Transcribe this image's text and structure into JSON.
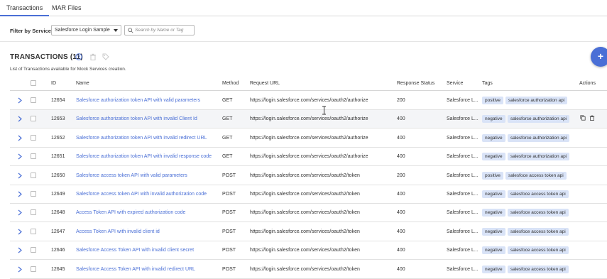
{
  "tabs": [
    {
      "label": "Transactions",
      "active": true
    },
    {
      "label": "MAR Files",
      "active": false
    }
  ],
  "filter": {
    "label": "Filter by Service:",
    "service_value": "Salesforce Login Sample",
    "search_placeholder": "Search by Name or Tag"
  },
  "section": {
    "title": "TRANSACTIONS (11)",
    "subtitle": "List of Transactions available for Mock Services creation."
  },
  "fab_label": "+",
  "columns": {
    "id": "ID",
    "name": "Name",
    "method": "Method",
    "url": "Request URL",
    "status": "Response Status",
    "service": "Service",
    "tags": "Tags",
    "actions": "Actions"
  },
  "rows": [
    {
      "id": "12654",
      "name": "Salesforce authorization token API with valid parameters",
      "method": "GET",
      "url": "https://login.salesforce.com/services/oauth2/authorize",
      "status": "200",
      "service": "Salesforce L...",
      "tag1": "positive",
      "tag2": "salesforce authorization api"
    },
    {
      "id": "12653",
      "name": "Salesforce authorization token API with invalid Client Id",
      "method": "GET",
      "url": "https://login.salesforce.com/services/oauth2/authorize",
      "status": "400",
      "service": "Salesforce L...",
      "tag1": "negative",
      "tag2": "salesforce authorization api"
    },
    {
      "id": "12652",
      "name": "Salesforce authorization token API with invalid redirect URL",
      "method": "GET",
      "url": "https://login.salesforce.com/services/oauth2/authorize",
      "status": "400",
      "service": "Salesforce L...",
      "tag1": "negative",
      "tag2": "salesforce authorization api"
    },
    {
      "id": "12651",
      "name": "Salesforce authorization token API with invalid response code",
      "method": "GET",
      "url": "https://login.salesforce.com/services/oauth2/authorize",
      "status": "400",
      "service": "Salesforce L...",
      "tag1": "negative",
      "tag2": "salesforce authorization api"
    },
    {
      "id": "12650",
      "name": "Salesforce access token API with valid parameters",
      "method": "POST",
      "url": "https://login.salesforce.com/services/oauth2/token",
      "status": "200",
      "service": "Salesforce L...",
      "tag1": "positive",
      "tag2": "salesfoce access token api"
    },
    {
      "id": "12649",
      "name": "Salesforce access token API with invalid authorization code",
      "method": "POST",
      "url": "https://login.salesforce.com/services/oauth2/token",
      "status": "400",
      "service": "Salesforce L...",
      "tag1": "negative",
      "tag2": "salesfoce access token api"
    },
    {
      "id": "12648",
      "name": "Access Token API with expired authorization code",
      "method": "POST",
      "url": "https://login.salesforce.com/services/oauth2/token",
      "status": "400",
      "service": "Salesforce L...",
      "tag1": "negative",
      "tag2": "salesfoce access token api"
    },
    {
      "id": "12647",
      "name": "Access Token API with invalid client id",
      "method": "POST",
      "url": "https://login.salesforce.com/services/oauth2/token",
      "status": "400",
      "service": "Salesforce L...",
      "tag1": "negative",
      "tag2": "salesfoce access token api"
    },
    {
      "id": "12646",
      "name": "Salesforce Access Token API with invalid client secret",
      "method": "POST",
      "url": "https://login.salesforce.com/services/oauth2/token",
      "status": "400",
      "service": "Salesforce L...",
      "tag1": "negative",
      "tag2": "salesfoce access token api"
    },
    {
      "id": "12645",
      "name": "Salesforce Access Token API with invalid redirect URL",
      "method": "POST",
      "url": "https://login.salesforce.com/services/oauth2/token",
      "status": "400",
      "service": "Salesforce L...",
      "tag1": "negative",
      "tag2": "salesfoce access token api"
    }
  ],
  "colors": {
    "accent": "#4a6fd6",
    "tag_bg": "#d9e3f7",
    "hover_row": "#f4f5f7"
  }
}
